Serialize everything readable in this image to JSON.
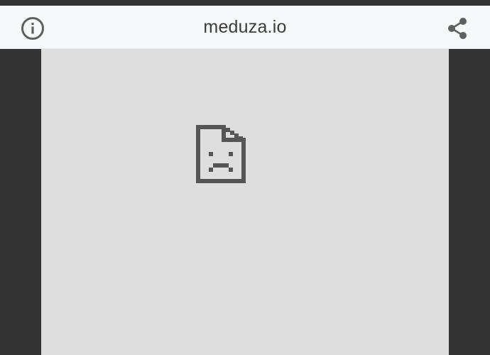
{
  "toolbar": {
    "url": "meduza.io",
    "info_icon": "info-circle-icon",
    "share_icon": "share-icon"
  },
  "content": {
    "error_icon": "sad-page-icon"
  },
  "colors": {
    "toolbar_bg": "#f7f8fa",
    "frame_bg": "#dedede",
    "chrome_dark": "#333333",
    "icon_gray": "#5f5f5f",
    "text": "#3c3c3c"
  }
}
